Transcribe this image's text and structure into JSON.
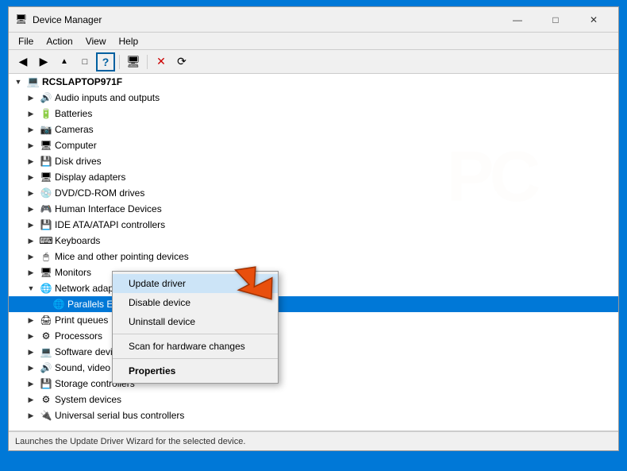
{
  "window": {
    "title": "Device Manager",
    "title_icon": "🖥",
    "buttons": {
      "minimize": "—",
      "maximize": "□",
      "close": "✕"
    }
  },
  "menubar": {
    "items": [
      "File",
      "Action",
      "View",
      "Help"
    ]
  },
  "toolbar": {
    "buttons": [
      {
        "name": "back",
        "icon": "←"
      },
      {
        "name": "forward",
        "icon": "→"
      },
      {
        "name": "up",
        "icon": "↑"
      },
      {
        "name": "show-hidden",
        "icon": "□"
      },
      {
        "name": "help",
        "icon": "?"
      },
      {
        "name": "sep1",
        "type": "sep"
      },
      {
        "name": "computer",
        "icon": "🖥"
      },
      {
        "name": "sep2",
        "type": "sep"
      },
      {
        "name": "remove",
        "icon": "✕"
      },
      {
        "name": "scan",
        "icon": "⟳"
      }
    ]
  },
  "tree": {
    "root": "RCSLAPTOP971F",
    "items": [
      {
        "id": "audio",
        "label": "Audio inputs and outputs",
        "icon": "🔊",
        "indent": 2,
        "expanded": false
      },
      {
        "id": "batteries",
        "label": "Batteries",
        "icon": "🔋",
        "indent": 2,
        "expanded": false
      },
      {
        "id": "cameras",
        "label": "Cameras",
        "icon": "📷",
        "indent": 2,
        "expanded": false
      },
      {
        "id": "computer",
        "label": "Computer",
        "icon": "🖥",
        "indent": 2,
        "expanded": false
      },
      {
        "id": "disk",
        "label": "Disk drives",
        "icon": "💾",
        "indent": 2,
        "expanded": false
      },
      {
        "id": "display",
        "label": "Display adapters",
        "icon": "🖥",
        "indent": 2,
        "expanded": false
      },
      {
        "id": "dvd",
        "label": "DVD/CD-ROM drives",
        "icon": "💿",
        "indent": 2,
        "expanded": false
      },
      {
        "id": "hid",
        "label": "Human Interface Devices",
        "icon": "🎮",
        "indent": 2,
        "expanded": false
      },
      {
        "id": "ide",
        "label": "IDE ATA/ATAPI controllers",
        "icon": "💾",
        "indent": 2,
        "expanded": false
      },
      {
        "id": "keyboards",
        "label": "Keyboards",
        "icon": "⌨",
        "indent": 2,
        "expanded": false
      },
      {
        "id": "mice",
        "label": "Mice and other pointing devices",
        "icon": "🖱",
        "indent": 2,
        "expanded": false
      },
      {
        "id": "monitors",
        "label": "Monitors",
        "icon": "🖥",
        "indent": 2,
        "expanded": false
      },
      {
        "id": "network",
        "label": "Network adapters",
        "icon": "🌐",
        "indent": 2,
        "expanded": true
      },
      {
        "id": "parallels",
        "label": "Parallels Ethernet Adapter",
        "icon": "🌐",
        "indent": 3,
        "expanded": false,
        "highlighted": true
      },
      {
        "id": "printq",
        "label": "Print queues",
        "icon": "🖨",
        "indent": 2,
        "expanded": false
      },
      {
        "id": "processor",
        "label": "Processors",
        "icon": "⚙",
        "indent": 2,
        "expanded": false
      },
      {
        "id": "software",
        "label": "Software devices",
        "icon": "💻",
        "indent": 2,
        "expanded": false
      },
      {
        "id": "sound",
        "label": "Sound, video and game controllers",
        "icon": "🔊",
        "indent": 2,
        "expanded": false
      },
      {
        "id": "storage",
        "label": "Storage controllers",
        "icon": "💾",
        "indent": 2,
        "expanded": false
      },
      {
        "id": "system",
        "label": "System devices",
        "icon": "⚙",
        "indent": 2,
        "expanded": false
      },
      {
        "id": "universal",
        "label": "Universal serial bus controllers",
        "icon": "🔌",
        "indent": 2,
        "expanded": false
      }
    ]
  },
  "context_menu": {
    "items": [
      {
        "id": "update",
        "label": "Update driver",
        "bold": false,
        "highlighted": true
      },
      {
        "id": "disable",
        "label": "Disable device",
        "bold": false
      },
      {
        "id": "uninstall",
        "label": "Uninstall device",
        "bold": false
      },
      {
        "id": "sep1",
        "type": "sep"
      },
      {
        "id": "scan",
        "label": "Scan for hardware changes",
        "bold": false
      },
      {
        "id": "sep2",
        "type": "sep"
      },
      {
        "id": "properties",
        "label": "Properties",
        "bold": true
      }
    ]
  },
  "status_bar": {
    "text": "Launches the Update Driver Wizard for the selected device."
  },
  "colors": {
    "accent": "#0078d7",
    "highlight_bg": "#cce4f7",
    "selected_bg": "#0078d7"
  }
}
